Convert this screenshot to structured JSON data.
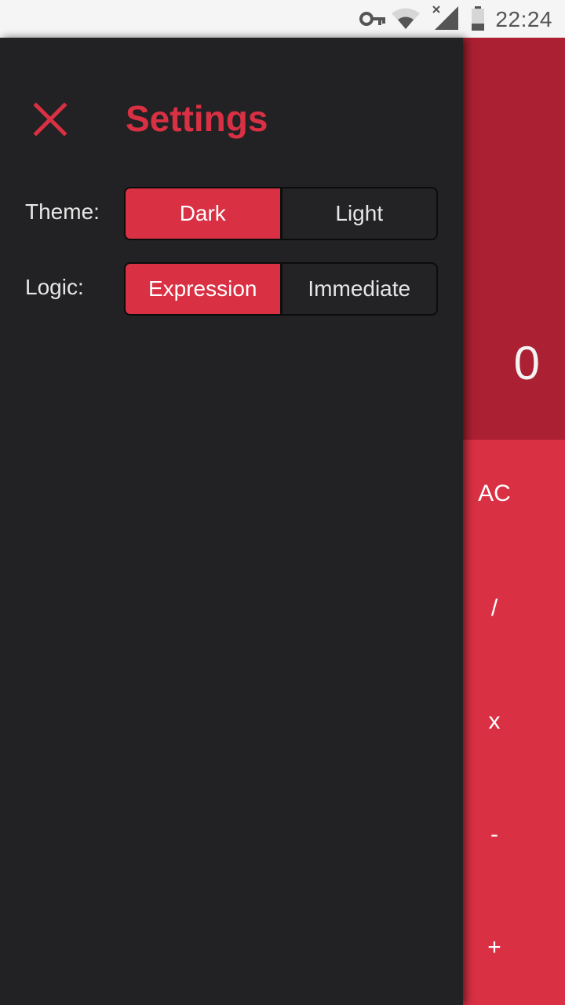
{
  "status_bar": {
    "time": "22:24",
    "icons": [
      "vpn-key-icon",
      "wifi-icon",
      "no-signal-icon",
      "battery-icon"
    ]
  },
  "drawer": {
    "title": "Settings",
    "close_icon": "close-icon",
    "settings": [
      {
        "label": "Theme:",
        "options": [
          "Dark",
          "Light"
        ],
        "selected": "Dark"
      },
      {
        "label": "Logic:",
        "options": [
          "Expression",
          "Immediate"
        ],
        "selected": "Expression"
      }
    ]
  },
  "calculator": {
    "display": "0",
    "operators": [
      "AC",
      "/",
      "x",
      "-",
      "+"
    ]
  },
  "colors": {
    "accent": "#d93044",
    "display_bg": "#ab2032",
    "drawer_bg": "#222224",
    "status_bar_bg": "#f5f5f5"
  }
}
